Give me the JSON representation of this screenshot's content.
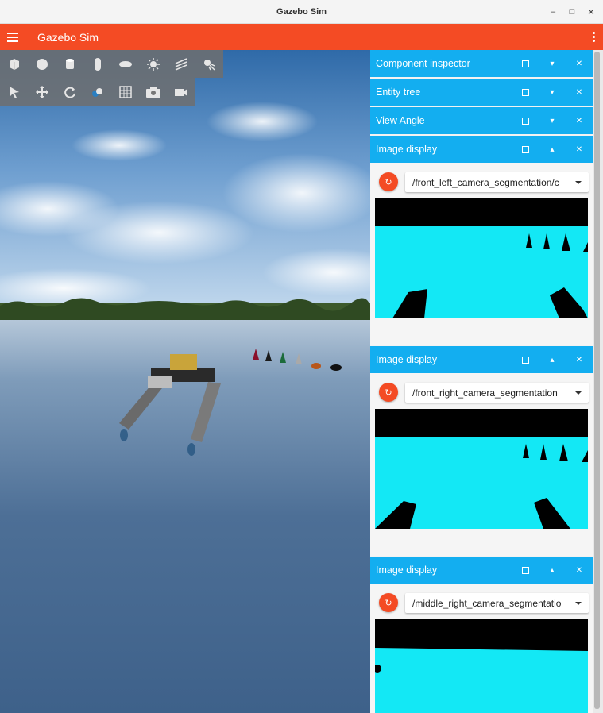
{
  "window": {
    "title": "Gazebo Sim",
    "minimize_glyph": "–",
    "maximize_glyph": "□",
    "close_glyph": "✕"
  },
  "appbar": {
    "title": "Gazebo Sim",
    "menu_icon": "hamburger-menu-icon",
    "overflow_icon": "kebab-menu-icon"
  },
  "toolbar": {
    "shapes": [
      "box",
      "sphere",
      "cylinder",
      "capsule",
      "ellipsoid",
      "sun-light",
      "directional-light",
      "spot-light"
    ],
    "transform": [
      "select",
      "translate",
      "rotate",
      "copy-paste",
      "grid",
      "screenshot",
      "video-record"
    ]
  },
  "panels": [
    {
      "title": "Component inspector",
      "collapse_glyph": "▾"
    },
    {
      "title": "Entity tree",
      "collapse_glyph": "▾"
    },
    {
      "title": "View Angle",
      "collapse_glyph": "▾"
    }
  ],
  "image_displays": [
    {
      "title": "Image display",
      "topic": "/front_left_camera_segmentation/c",
      "collapse_glyph": "▴"
    },
    {
      "title": "Image display",
      "topic": "/front_right_camera_segmentation",
      "collapse_glyph": "▴"
    },
    {
      "title": "Image display",
      "topic": "/middle_right_camera_segmentatio",
      "collapse_glyph": "▴"
    }
  ],
  "icons": {
    "float": "□",
    "close": "✕",
    "refresh": "↻"
  },
  "colors": {
    "accent": "#f44b24",
    "panel_header": "#13aef0",
    "segmentation_water": "#13e8f5",
    "segmentation_object": "#000000"
  }
}
